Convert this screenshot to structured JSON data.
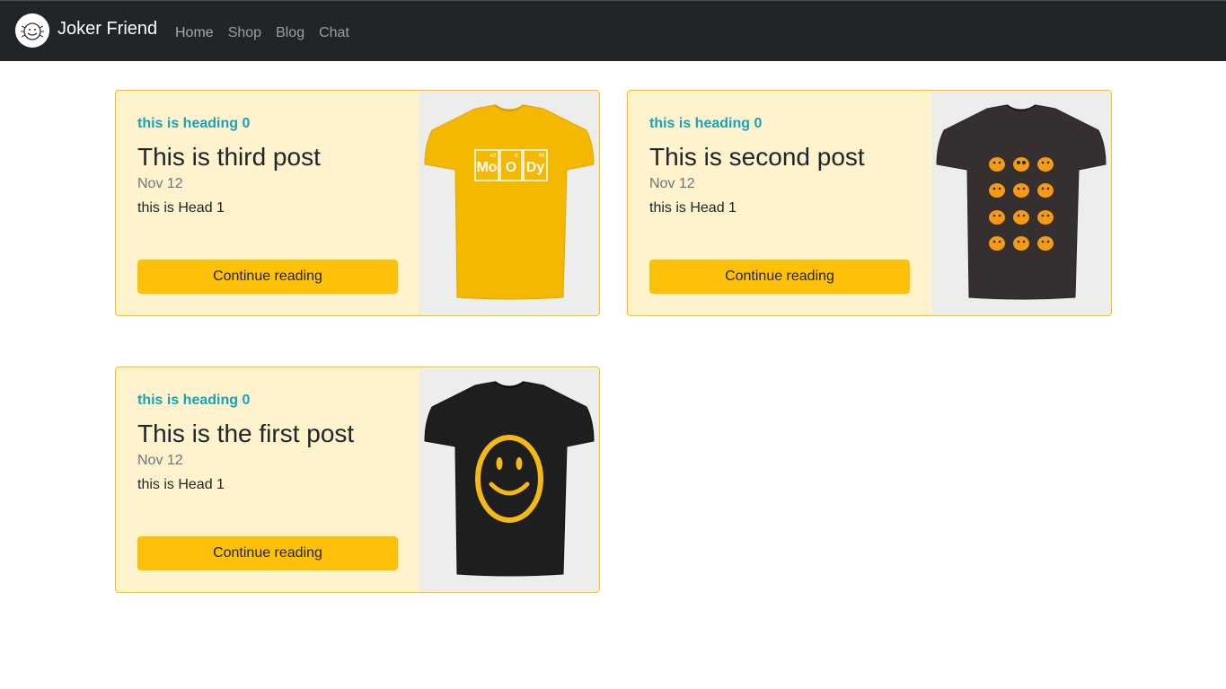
{
  "nav": {
    "brand": "Joker Friend",
    "links": [
      "Home",
      "Shop",
      "Blog",
      "Chat"
    ]
  },
  "colors": {
    "navbar": "#212529",
    "card_bg": "#fff3cd",
    "card_border": "#ffc107",
    "heading": "#17a2b8",
    "button": "#ffc107"
  },
  "posts": [
    {
      "heading": "this is heading 0",
      "title": "This is third post",
      "date": "Nov 12",
      "text": "this is Head 1",
      "button": "Continue reading",
      "image": "yellow-moody-tshirt",
      "shirt_text": [
        "Mo",
        "O",
        "Dy"
      ],
      "shirt_numbers": [
        "42",
        "8",
        "66"
      ]
    },
    {
      "heading": "this is heading 0",
      "title": "This is second post",
      "date": "Nov 12",
      "text": "this is Head 1",
      "button": "Continue reading",
      "image": "pumpkin-emoji-tshirt"
    },
    {
      "heading": "this is heading 0",
      "title": "This is the first post",
      "date": "Nov 12",
      "text": "this is Head 1",
      "button": "Continue reading",
      "image": "smiley-tshirt"
    }
  ]
}
